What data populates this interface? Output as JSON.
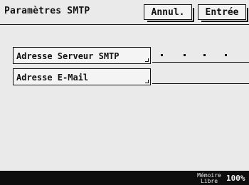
{
  "header": {
    "title": "Paramètres SMTP",
    "cancel_label": "Annul.",
    "enter_label": "Entrée"
  },
  "fields": [
    {
      "label": "Adresse Serveur SMTP",
      "value": ". . . ."
    },
    {
      "label": "Adresse E-Mail",
      "value": ""
    }
  ],
  "status": {
    "memory_label": "Mémoire Libre",
    "memory_value": "100%"
  }
}
